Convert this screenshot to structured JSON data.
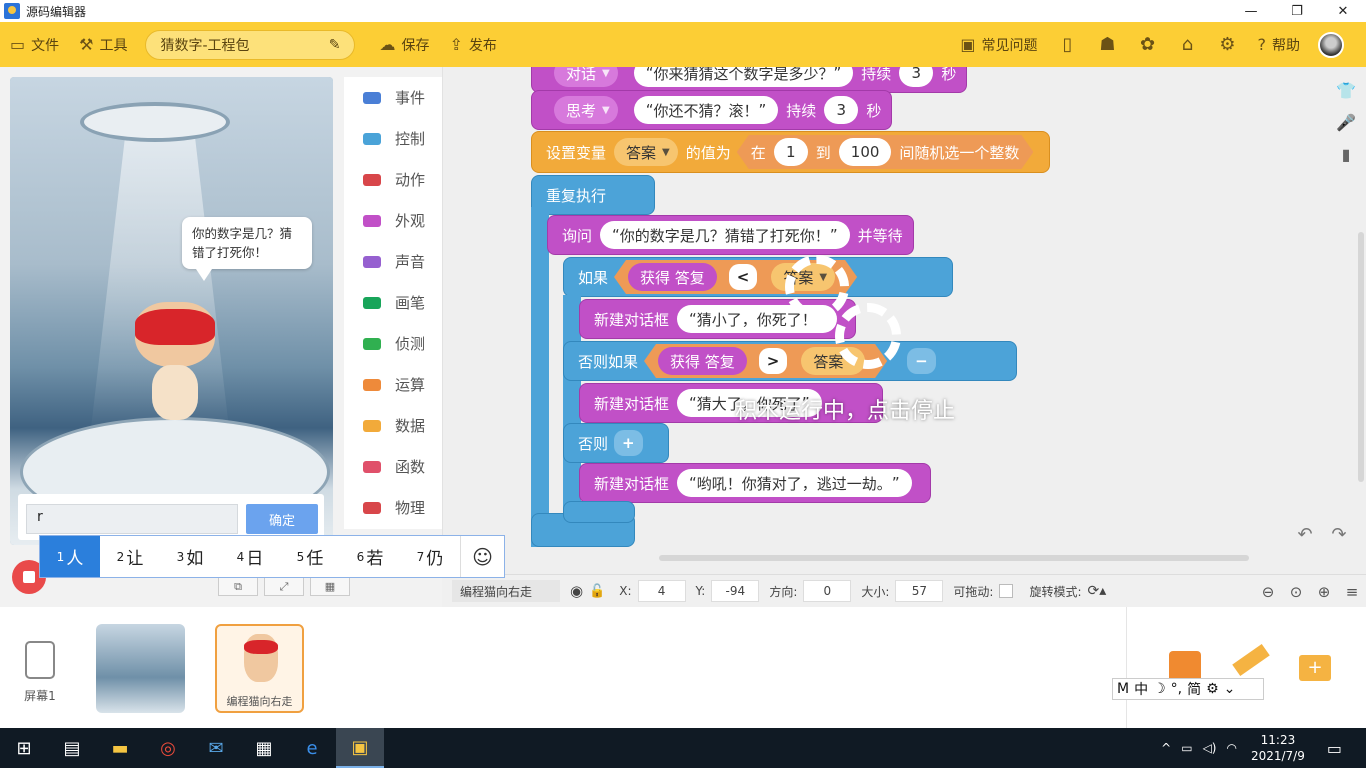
{
  "window": {
    "title": "源码编辑器",
    "min": "—",
    "max": "❐",
    "close": "✕"
  },
  "toolbar": {
    "file": "文件",
    "tools": "工具",
    "project_name": "猜数字-工程包",
    "save": "保存",
    "publish": "发布",
    "faq": "常见问题",
    "help": "帮助"
  },
  "stage": {
    "bubble": "你的数字是几？猜错了打死你！",
    "answer_value": "r",
    "confirm": "确定"
  },
  "ime": {
    "candidates": [
      {
        "n": "1",
        "t": "人"
      },
      {
        "n": "2",
        "t": "让"
      },
      {
        "n": "3",
        "t": "如"
      },
      {
        "n": "4",
        "t": "日"
      },
      {
        "n": "5",
        "t": "任"
      },
      {
        "n": "6",
        "t": "若"
      },
      {
        "n": "7",
        "t": "仍"
      }
    ],
    "emoji": "☺"
  },
  "categories": [
    {
      "label": "事件",
      "color": "#4a7fd6"
    },
    {
      "label": "控制",
      "color": "#4aa3d8"
    },
    {
      "label": "动作",
      "color": "#d8464a"
    },
    {
      "label": "外观",
      "color": "#c150c7"
    },
    {
      "label": "声音",
      "color": "#9660d0"
    },
    {
      "label": "画笔",
      "color": "#18a55a"
    },
    {
      "label": "侦测",
      "color": "#30b050"
    },
    {
      "label": "运算",
      "color": "#ee8a3a"
    },
    {
      "label": "数据",
      "color": "#f2aa3a"
    },
    {
      "label": "函数",
      "color": "#e0506a"
    },
    {
      "label": "物理",
      "color": "#d8464a"
    }
  ],
  "blocks": {
    "talk_label": "对话",
    "talk_text": "你来猜猜这个数字是多少？",
    "talk_keep": "持续",
    "talk_sec": "3",
    "talk_unit": "秒",
    "think_label": "思考",
    "think_text": "你还不猜？滚！",
    "think_keep": "持续",
    "think_sec": "3",
    "think_unit": "秒",
    "setvar_label": "设置变量",
    "setvar_var": "答案",
    "setvar_of": "的值为",
    "rand_in": "在",
    "rand_from": "1",
    "rand_to_label": "到",
    "rand_to": "100",
    "rand_tail": "间随机选一个整数",
    "repeat": "重复执行",
    "ask_label": "询问",
    "ask_text": "你的数字是几？猜错了打死你！",
    "ask_wait": "并等待",
    "if_label": "如果",
    "get_answer": "获得 答复",
    "lt": "<",
    "answer_var": "答案",
    "dialog1_label": "新建对话框",
    "dialog1_text": "猜小了，你死了！",
    "elif_label": "否则如果",
    "get_answer2": "获得 答复",
    "gt": ">",
    "answer_var2": "答案",
    "minus": "−",
    "dialog2_label": "新建对话框",
    "dialog2_text": "猜大了，你死了",
    "else_label": "否则",
    "plus": "+",
    "dialog3_label": "新建对话框",
    "dialog3_text": "哟吼！你猜对了，逃过一劫。",
    "running": "积木运行中，点击停止"
  },
  "status": {
    "sprite": "编程猫向右走",
    "x_label": "X:",
    "x": "4",
    "y_label": "Y:",
    "y": "-94",
    "dir_label": "方向:",
    "dir": "0",
    "size_label": "大小:",
    "size": "57",
    "drag_label": "可拖动:",
    "rot_label": "旋转模式:"
  },
  "bottom": {
    "screen": "屏幕1",
    "sprite_thumb": "编程猫向右走"
  },
  "imebar": [
    "M",
    "中",
    "☽",
    "°,",
    "简",
    "⚙",
    "⌄"
  ],
  "taskbar": {
    "time": "11:23",
    "date": "2021/7/9"
  }
}
